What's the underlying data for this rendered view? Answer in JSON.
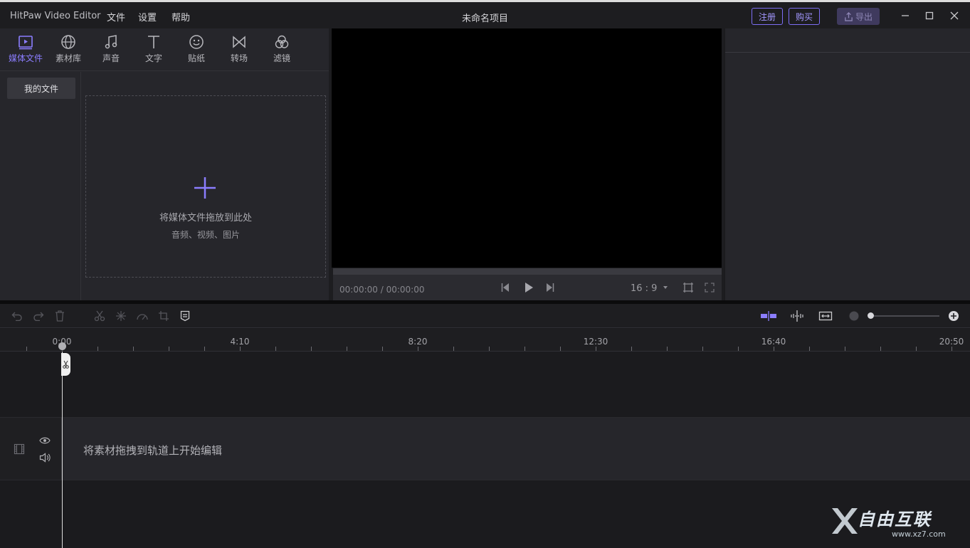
{
  "app": {
    "name": "HitPaw Video Editor",
    "project_title": "未命名项目",
    "menu": [
      "文件",
      "设置",
      "帮助"
    ],
    "register_label": "注册",
    "buy_label": "购买",
    "export_label": "导出"
  },
  "tool_tabs": [
    {
      "label": "媒体文件",
      "icon": "media-icon",
      "active": true
    },
    {
      "label": "素材库",
      "icon": "globe-icon",
      "active": false
    },
    {
      "label": "声音",
      "icon": "music-icon",
      "active": false
    },
    {
      "label": "文字",
      "icon": "text-icon",
      "active": false
    },
    {
      "label": "贴纸",
      "icon": "sticker-icon",
      "active": false
    },
    {
      "label": "转场",
      "icon": "transition-icon",
      "active": false
    },
    {
      "label": "滤镜",
      "icon": "filter-icon",
      "active": false
    }
  ],
  "media": {
    "my_files_label": "我的文件",
    "drop_main": "将媒体文件拖放到此处",
    "drop_sub": "音频、视频、图片"
  },
  "preview": {
    "timecode": "00:00:00 / 00:00:00",
    "aspect_ratio": "16 : 9"
  },
  "timeline": {
    "ruler_labels": [
      "0:00",
      "4:10",
      "8:20",
      "12:30",
      "16:40",
      "20:50"
    ],
    "track_hint": "将素材拖拽到轨道上开始编辑"
  },
  "watermark": {
    "text": "自由互联",
    "url": "www.xz7.com"
  },
  "colors": {
    "accent": "#8b7dff",
    "background": "#1a1a1d",
    "panel": "#26262b"
  }
}
